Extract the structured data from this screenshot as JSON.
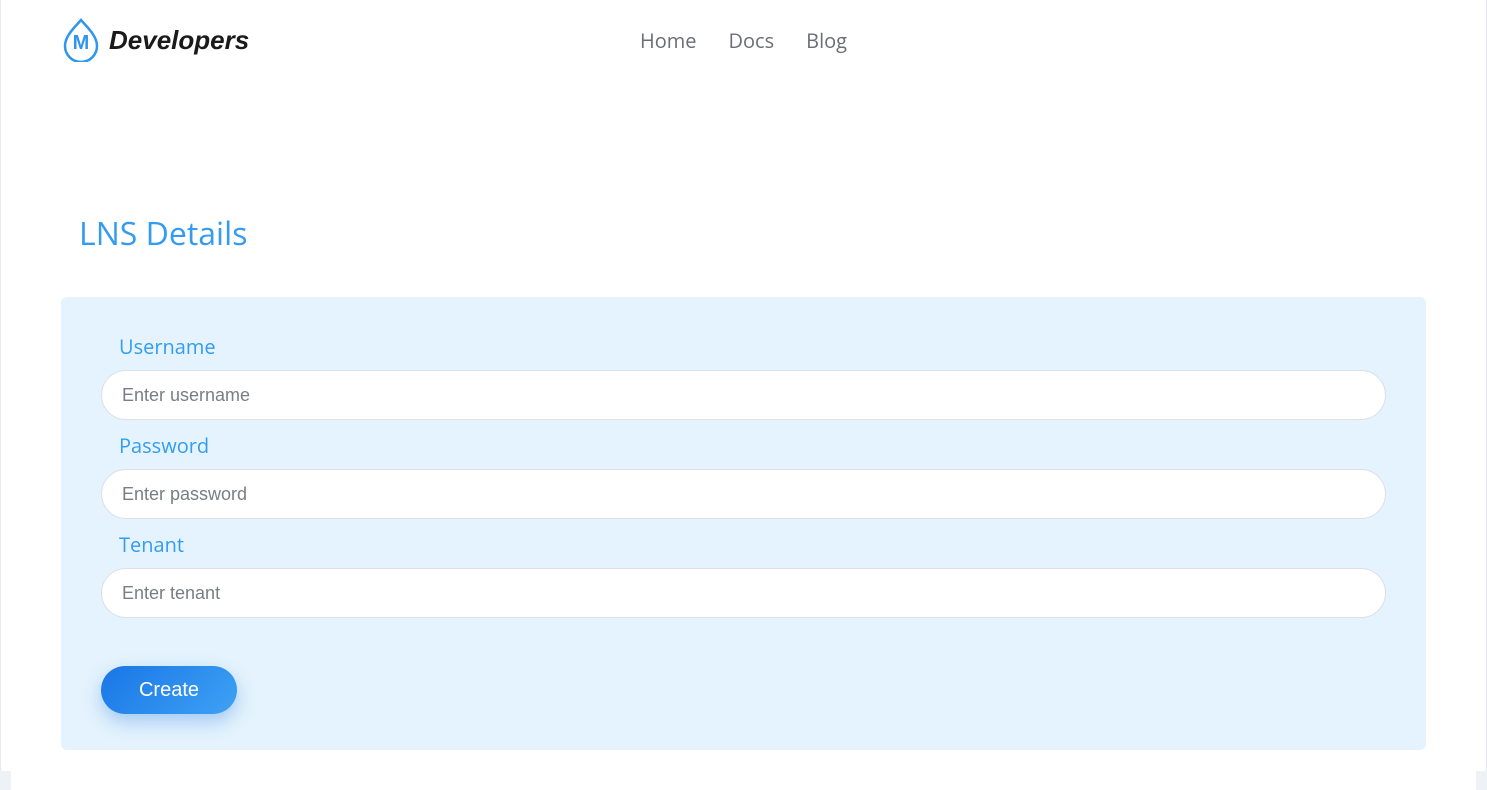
{
  "brand": {
    "name": "Developers",
    "logo_letter": "M"
  },
  "nav": {
    "items": [
      {
        "label": "Home"
      },
      {
        "label": "Docs"
      },
      {
        "label": "Blog"
      }
    ]
  },
  "section": {
    "title": "LNS Details"
  },
  "form": {
    "fields": {
      "username": {
        "label": "Username",
        "placeholder": "Enter username",
        "value": ""
      },
      "password": {
        "label": "Password",
        "placeholder": "Enter password",
        "value": ""
      },
      "tenant": {
        "label": "Tenant",
        "placeholder": "Enter tenant",
        "value": ""
      }
    },
    "submit_label": "Create"
  },
  "colors": {
    "accent": "#339cf0",
    "card_bg": "#e4f3fd",
    "button_gradient_start": "#1976e6",
    "button_gradient_end": "#3ea2f4"
  }
}
